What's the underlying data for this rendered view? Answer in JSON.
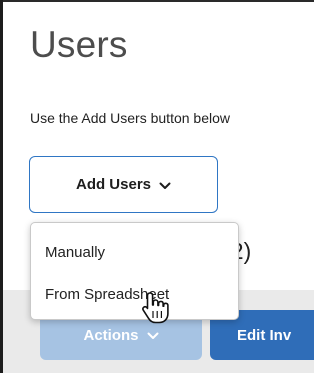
{
  "page": {
    "title": "Users",
    "instructions": "Use the Add Users button below"
  },
  "add_users": {
    "label": "Add Users",
    "icon": "chevron-down-icon"
  },
  "dropdown": {
    "items": [
      {
        "label": "Manually"
      },
      {
        "label": "From Spreadsheet"
      }
    ]
  },
  "list": {
    "count_fragment": "22)"
  },
  "toolbar": {
    "actions_label": "Actions",
    "actions_icon": "chevron-down-icon",
    "edit_label": "Edit Inv"
  },
  "cursor": {
    "icon": "hand-pointer-icon"
  },
  "colors": {
    "accent": "#2f76c4",
    "primary_button": "#2f6db8",
    "disabled_button": "#a6c3e3",
    "toolbar_background": "#eaeaea",
    "title_text": "#4d4d4d"
  }
}
